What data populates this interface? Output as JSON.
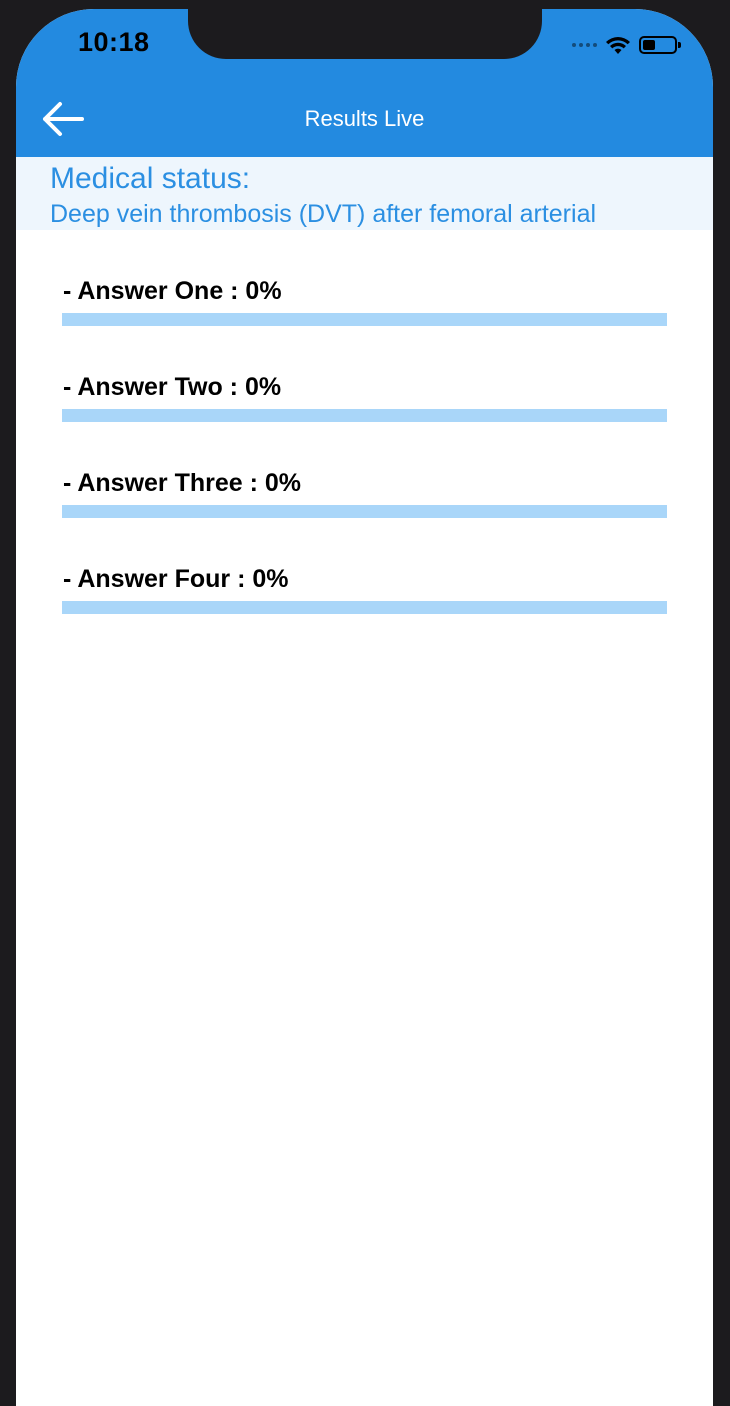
{
  "status_bar": {
    "time": "10:18"
  },
  "header": {
    "title": "Results Live",
    "back_icon": "arrow-left-icon",
    "color": "#238ae0"
  },
  "medical": {
    "label": "Medical status:",
    "text": "Deep vein thrombosis (DVT) after femoral arterial"
  },
  "answers": [
    {
      "label": "- Answer One : 0%",
      "percent": 0
    },
    {
      "label": "- Answer Two : 0%",
      "percent": 0
    },
    {
      "label": "- Answer Three : 0%",
      "percent": 0
    },
    {
      "label": "- Answer Four : 0%",
      "percent": 0
    }
  ],
  "colors": {
    "bar_track": "#a9d6f9",
    "bar_fill": "#238ae0",
    "accent_text": "#2b8fe2"
  }
}
